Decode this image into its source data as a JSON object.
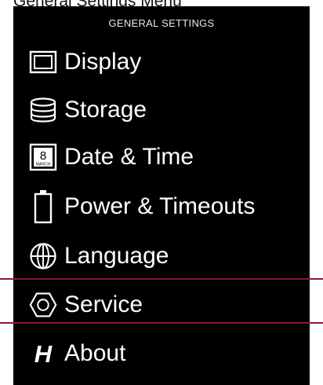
{
  "caption": "General Settings Menu",
  "header": {
    "title": "GENERAL SETTINGS"
  },
  "menu": {
    "items": [
      {
        "label": "Display",
        "icon": "display-icon"
      },
      {
        "label": "Storage",
        "icon": "storage-icon"
      },
      {
        "label": "Date & Time",
        "icon": "calendar-icon",
        "icon_day": "8",
        "icon_month": "MARCH"
      },
      {
        "label": "Power & Timeouts",
        "icon": "battery-icon"
      },
      {
        "label": "Language",
        "icon": "globe-icon"
      },
      {
        "label": "Service",
        "icon": "hex-nut-icon"
      },
      {
        "label": "About",
        "icon": "hasselblad-logo-icon",
        "icon_text": "H"
      }
    ],
    "selected": "Service"
  },
  "colors": {
    "background": "#000000",
    "text": "#ffffff",
    "selection": "#8b1a2e"
  }
}
